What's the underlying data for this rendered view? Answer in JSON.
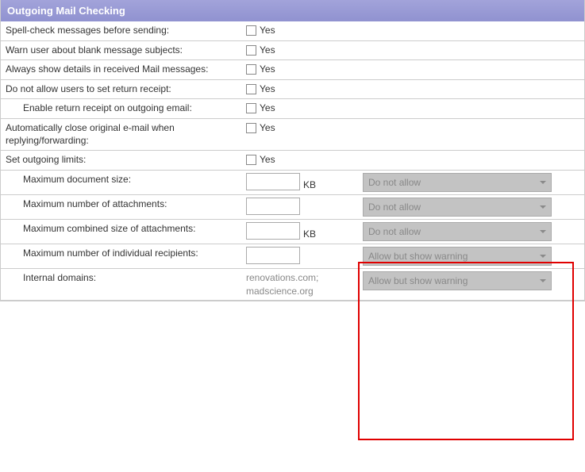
{
  "panel": {
    "title": "Outgoing Mail Checking",
    "yes_label": "Yes",
    "rows": {
      "spell_check": "Spell-check messages before sending:",
      "blank_subject": "Warn user about blank message subjects:",
      "show_details": "Always show details in received Mail messages:",
      "no_return_receipt": "Do not allow users to set return receipt:",
      "enable_return_receipt": "Enable return receipt on outgoing email:",
      "auto_close": "Automatically close original e-mail when replying/forwarding:",
      "set_limits": "Set outgoing limits:",
      "max_doc_size": "Maximum document size:",
      "max_attachments": "Maximum number of attachments:",
      "max_combined_size": "Maximum combined size of attachments:",
      "max_recipients": "Maximum number of individual recipients:",
      "internal_domains": "Internal domains:"
    },
    "units": {
      "kb": "KB"
    },
    "internal_domains_value": "renovations.com; madscience.org",
    "select_options": {
      "do_not_allow": "Do not allow",
      "allow_warn": "Allow but show warning"
    },
    "selected": {
      "max_doc_size": "Do not allow",
      "max_attachments": "Do not allow",
      "max_combined_size": "Do not allow",
      "max_recipients": "Allow but show warning",
      "internal_domains": "Allow but show warning"
    }
  }
}
